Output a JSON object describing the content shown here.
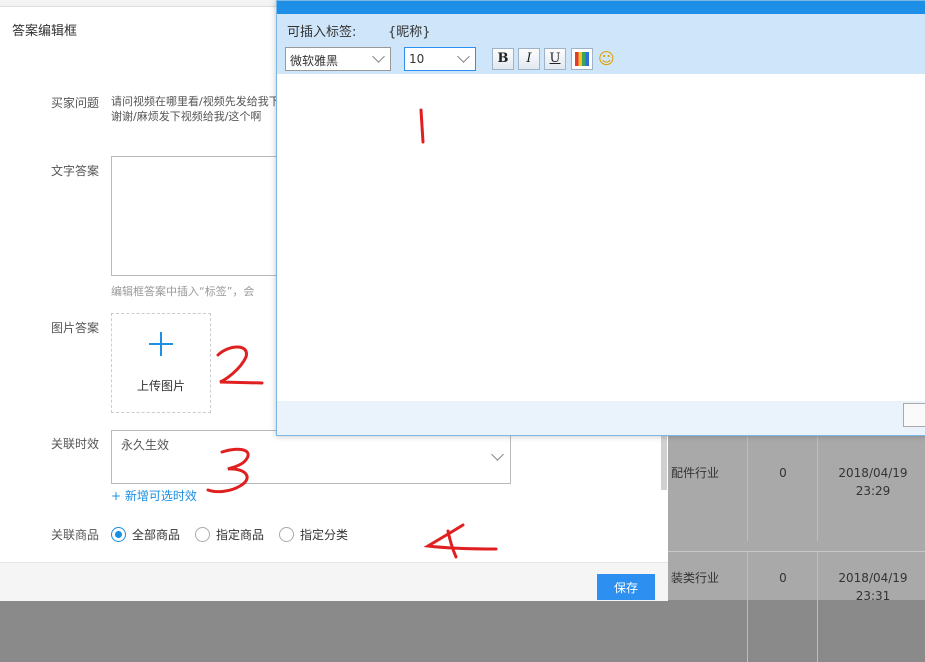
{
  "panel": {
    "title": "答案编辑框",
    "question_label": "买家问题",
    "question_text": "请问视频在哪里看/视频先发给我下谢谢/麻烦发下视频给我/这个啊",
    "text_answer_label": "文字答案",
    "hint": "编辑框答案中插入“标签”，会",
    "image_answer_label": "图片答案",
    "upload_label": "上传图片",
    "time_label": "关联时效",
    "time_value": "永久生效",
    "add_time_link": "新增可选时效",
    "product_label": "关联商品",
    "radios": [
      {
        "label": "全部商品",
        "checked": true
      },
      {
        "label": "指定商品",
        "checked": false
      },
      {
        "label": "指定分类",
        "checked": false
      }
    ],
    "save_label": "保存"
  },
  "modal": {
    "tags_label": "可插入标签:",
    "tags_value": "{昵称}",
    "font_value": "微软雅黑",
    "size_value": "10",
    "bold": "B",
    "italic": "I",
    "underline": "U",
    "emoji": "☺"
  },
  "background_table": {
    "rows": [
      {
        "industry": "配件行业",
        "count": "0",
        "date": "2018/04/19",
        "time": "23:29"
      },
      {
        "industry": "装类行业",
        "count": "0",
        "date": "2018/04/19",
        "time": "23:31"
      }
    ]
  },
  "annotations": [
    "1",
    "2",
    "3",
    "4"
  ],
  "colors": {
    "accent": "#1a8fe3",
    "save_button": "#2d8ff0",
    "annotation": "#e02020"
  }
}
